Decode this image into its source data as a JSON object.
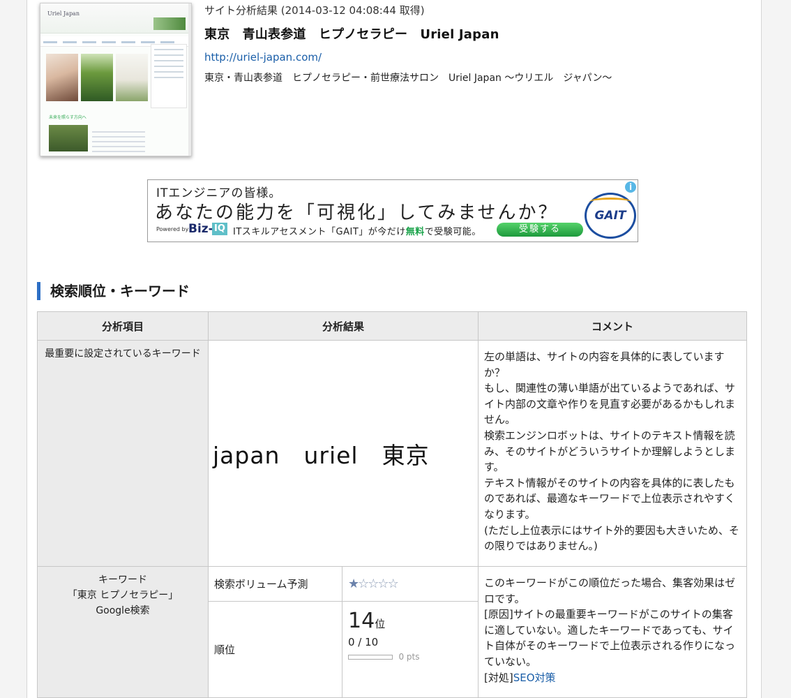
{
  "site": {
    "meta": "サイト分析結果 (2014-03-12 04:08:44 取得)",
    "title": "東京　青山表参道　ヒプノセラピー　Uriel Japan",
    "url": "http://uriel-japan.com/",
    "description": "東京・青山表参道　ヒプノセラピー・前世療法サロン　Uriel Japan ～ウリエル　ジャパン～",
    "thumbnail": {
      "site_name": "Uriel Japan",
      "subheading": "未来を照らす方向へ"
    }
  },
  "ad": {
    "line1": "ITエンジニアの皆様。",
    "line2": "あなたの能力を「可視化」してみませんか？",
    "powered_by": "Powered by",
    "brand": "Biz-",
    "brand_iq": "IQ",
    "line3_prefix": "ITスキルアセスメント「GAIT」が今だけ",
    "line3_free": "無料",
    "line3_suffix": "で受験可能。",
    "button": "受験する",
    "logo_text": "GAIT",
    "info_icon": "i"
  },
  "section": {
    "title": "検索順位・キーワード"
  },
  "table": {
    "headers": [
      "分析項目",
      "分析結果",
      "コメント"
    ],
    "row1": {
      "item": "最重要に設定されているキーワード",
      "keywords": "japan　uriel　東京",
      "comment": "左の単語は、サイトの内容を具体的に表していますか？\nもし、関連性の薄い単語が出ているようであれば、サイト内部の文章や作りを見直す必要があるかもしれません。\n検索エンジンロボットは、サイトのテキスト情報を読み、そのサイトがどういうサイトか理解しようとします。\nテキスト情報がそのサイトの内容を具体的に表したものであれば、最適なキーワードで上位表示されやすくなります。\n(ただし上位表示にはサイト外的要因も大きいため、その限りではありません。)"
    },
    "row2": {
      "item_line1": "キーワード",
      "item_line2": "「東京 ヒプノセラピー」",
      "item_line3": "Google検索",
      "volume_label": "検索ボリューム予測",
      "volume_rating": 1,
      "volume_max": 5,
      "rank_label": "順位",
      "rank_value": "14",
      "rank_unit": "位",
      "score": "0 / 10",
      "score_fraction": 0,
      "pts": "0 pts",
      "comment": "このキーワードがこの順位だった場合、集客効果はゼロです。\n[原因]サイトの最重要キーワードがこのサイトの集客に適していない。適したキーワードであっても、サイト自体がそのキーワードで上位表示される作りになっていない。",
      "comment_action_prefix": "[対処]",
      "comment_action_link": "SEO対策"
    }
  }
}
